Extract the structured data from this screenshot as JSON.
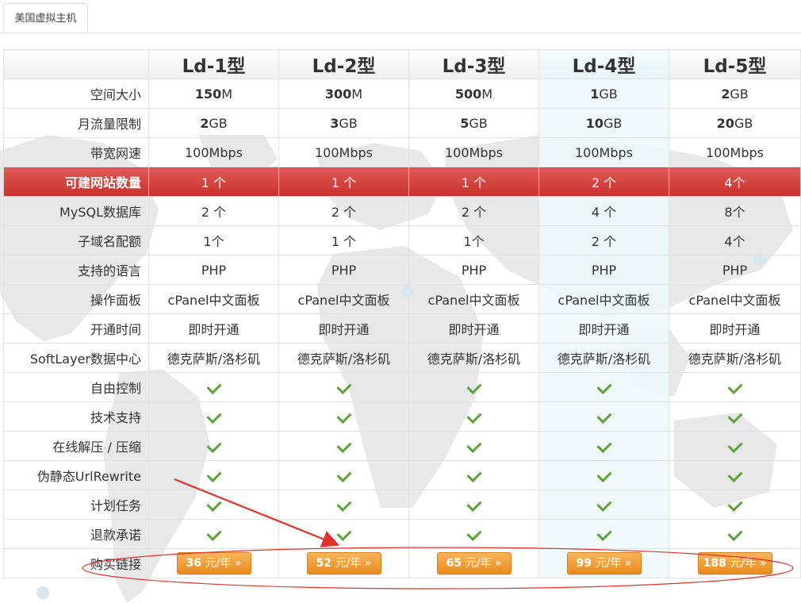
{
  "tab": {
    "label": "美国虚拟主机"
  },
  "plans": [
    "Ld-1型",
    "Ld-2型",
    "Ld-3型",
    "Ld-4型",
    "Ld-5型"
  ],
  "rows": [
    {
      "label": "空间大小",
      "cells": [
        [
          "150",
          "M"
        ],
        [
          "300",
          "M"
        ],
        [
          "500",
          "M"
        ],
        [
          "1",
          "GB"
        ],
        [
          "2",
          "GB"
        ]
      ]
    },
    {
      "label": "月流量限制",
      "cells": [
        [
          "2",
          "GB"
        ],
        [
          "3",
          "GB"
        ],
        [
          "5",
          "GB"
        ],
        [
          "10",
          "GB"
        ],
        [
          "20",
          "GB"
        ]
      ]
    },
    {
      "label": "带宽网速",
      "cells": [
        "100Mbps",
        "100Mbps",
        "100Mbps",
        "100Mbps",
        "100Mbps"
      ]
    },
    {
      "label": "可建网站数量",
      "cells": [
        "1 个",
        "1 个",
        "1 个",
        "2 个",
        "4个"
      ],
      "highlight": true
    },
    {
      "label": "MySQL数据库",
      "cells": [
        "2 个",
        "2 个",
        "2 个",
        "4 个",
        "8个"
      ]
    },
    {
      "label": "子域名配额",
      "cells": [
        "1个",
        "1 个",
        "1个",
        "2 个",
        "4个"
      ]
    },
    {
      "label": "支持的语言",
      "cells": [
        "PHP",
        "PHP",
        "PHP",
        "PHP",
        "PHP"
      ]
    },
    {
      "label": "操作面板",
      "cells": [
        "cPanel中文面板",
        "cPanel中文面板",
        "cPanel中文面板",
        "cPanel中文面板",
        "cPanel中文面板"
      ]
    },
    {
      "label": "开通时间",
      "cells": [
        "即时开通",
        "即时开通",
        "即时开通",
        "即时开通",
        "即时开通"
      ]
    },
    {
      "label": "SoftLayer数据中心",
      "cells": [
        "德克萨斯/洛杉矶",
        "德克萨斯/洛杉矶",
        "德克萨斯/洛杉矶",
        "德克萨斯/洛杉矶",
        "德克萨斯/洛杉矶"
      ]
    }
  ],
  "check_rows": [
    "自由控制",
    "技术支持",
    "在线解压 / 压缩",
    "伪静态UrlRewrite",
    "计划任务",
    "退款承诺"
  ],
  "check_icon": "check-icon",
  "buy": {
    "label": "购买链接",
    "buttons": [
      {
        "price": "36",
        "unit": "元/年 »"
      },
      {
        "price": "52",
        "unit": "元/年 »"
      },
      {
        "price": "65",
        "unit": "元/年 »"
      },
      {
        "price": "99",
        "unit": "元/年 »"
      },
      {
        "price": "188",
        "unit": "元/年 »"
      }
    ]
  },
  "colors": {
    "highlight_row": "#d23b36",
    "buy_button": "#f0a03c",
    "check": "#5ca339",
    "annotation": "#e0322b",
    "highlight_column": "#eef8fc"
  }
}
